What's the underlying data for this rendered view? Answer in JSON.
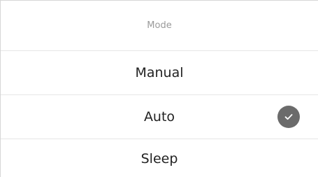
{
  "dialog": {
    "title": "Mode",
    "options": [
      {
        "label": "Manual",
        "selected": false
      },
      {
        "label": "Auto",
        "selected": true
      },
      {
        "label": "Sleep",
        "selected": false
      }
    ],
    "selected_icon": "check-circle-icon",
    "colors": {
      "title": "#9a9a9a",
      "option_text": "#222222",
      "check_bg": "#6b6b6b",
      "divider": "#e6e6e6"
    }
  }
}
